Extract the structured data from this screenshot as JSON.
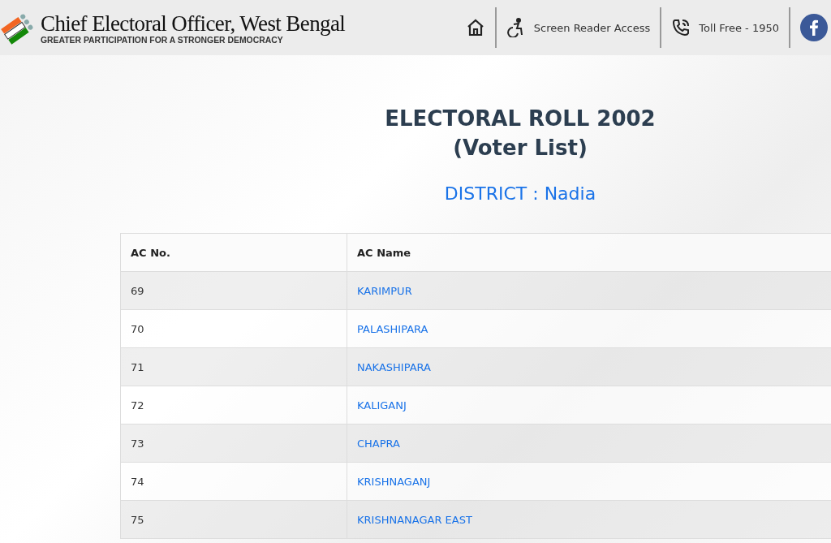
{
  "header": {
    "title": "Chief Electoral Officer, West Bengal",
    "tagline": "GREATER PARTICIPATION FOR A STRONGER DEMOCRACY",
    "links": [
      {
        "kind": "home"
      },
      {
        "kind": "accessibility",
        "label": "Screen Reader Access"
      },
      {
        "kind": "phone",
        "label": "Toll Free - 1950"
      },
      {
        "kind": "facebook"
      }
    ]
  },
  "heading": {
    "title": "ELECTORAL ROLL 2002",
    "subtitle": "(Voter List)",
    "district": "DISTRICT : Nadia"
  },
  "table": {
    "columns": [
      "AC No.",
      "AC Name"
    ],
    "rows": [
      {
        "no": "69",
        "name": "KARIMPUR"
      },
      {
        "no": "70",
        "name": "PALASHIPARA"
      },
      {
        "no": "71",
        "name": "NAKASHIPARA"
      },
      {
        "no": "72",
        "name": "KALIGANJ"
      },
      {
        "no": "73",
        "name": "CHAPRA"
      },
      {
        "no": "74",
        "name": "KRISHNAGANJ"
      },
      {
        "no": "75",
        "name": "KRISHNANAGAR EAST"
      }
    ]
  }
}
